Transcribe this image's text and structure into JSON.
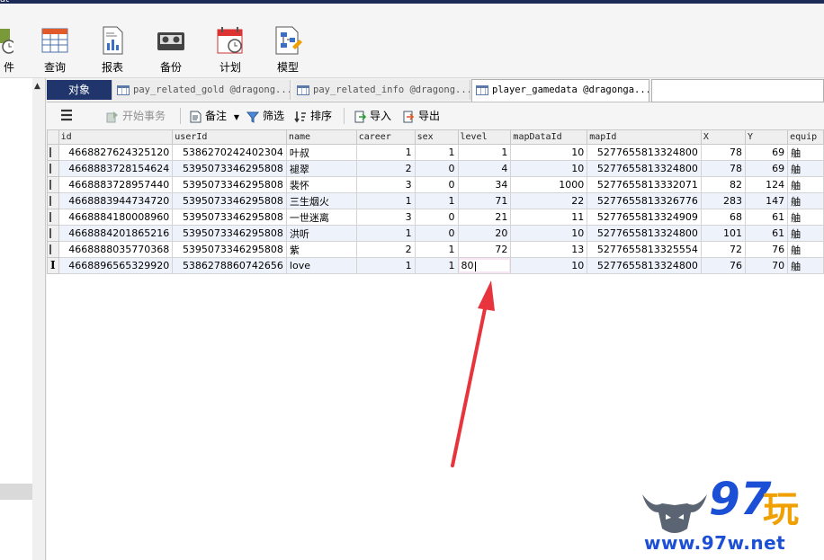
{
  "window": {
    "title_fragment": "at"
  },
  "ribbon": {
    "items": [
      {
        "label": "件",
        "icon": "function-clock-icon"
      },
      {
        "label": "查询",
        "icon": "query-table-icon"
      },
      {
        "label": "报表",
        "icon": "report-icon"
      },
      {
        "label": "备份",
        "icon": "backup-tape-icon"
      },
      {
        "label": "计划",
        "icon": "schedule-calendar-icon"
      },
      {
        "label": "模型",
        "icon": "model-diagram-icon"
      }
    ]
  },
  "tabs": {
    "objects_label": "对象",
    "items": [
      {
        "label": "pay_related_gold @dragong..."
      },
      {
        "label": "pay_related_info @dragong..."
      },
      {
        "label": "player_gamedata @dragonga..."
      }
    ]
  },
  "toolbar": {
    "menu_icon": "hamburger-menu-icon",
    "begin_transaction": "开始事务",
    "note": "备注",
    "filter": "筛选",
    "sort": "排序",
    "import": "导入",
    "export": "导出"
  },
  "grid": {
    "columns": [
      "id",
      "userId",
      "name",
      "career",
      "sex",
      "level",
      "mapDataId",
      "mapId",
      "X",
      "Y",
      "equip"
    ],
    "rows": [
      [
        "4668827624325120",
        "5386270242402304",
        "叶叔",
        "1",
        "1",
        "1",
        "10",
        "5277655813324800",
        "78",
        "69",
        "舳"
      ],
      [
        "4668883728154624",
        "5395073346295808",
        "褪翠",
        "2",
        "0",
        "4",
        "10",
        "5277655813324800",
        "78",
        "69",
        "舳"
      ],
      [
        "4668883728957440",
        "5395073346295808",
        "裴怀",
        "3",
        "0",
        "34",
        "1000",
        "5277655813332071",
        "82",
        "124",
        "舳"
      ],
      [
        "4668883944734720",
        "5395073346295808",
        "三生烟火",
        "1",
        "1",
        "71",
        "22",
        "5277655813326776",
        "283",
        "147",
        "舳"
      ],
      [
        "4668884180008960",
        "5395073346295808",
        "一世迷离",
        "3",
        "0",
        "21",
        "11",
        "5277655813324909",
        "68",
        "61",
        "舳"
      ],
      [
        "4668884201865216",
        "5395073346295808",
        "洪听",
        "1",
        "0",
        "20",
        "10",
        "5277655813324800",
        "101",
        "61",
        "舳"
      ],
      [
        "4668888035770368",
        "5395073346295808",
        "紫",
        "2",
        "1",
        "72",
        "13",
        "5277655813325554",
        "72",
        "76",
        "舳"
      ],
      [
        "4668896565329920",
        "5386278860742656",
        "love",
        "1",
        "1",
        "80",
        "10",
        "5277655813324800",
        "76",
        "70",
        "舳"
      ]
    ],
    "editing_row": 7,
    "editing_value": "80"
  },
  "watermark": {
    "number": "97",
    "char": "玩",
    "url": "www.97w.net"
  },
  "colors": {
    "annotation_arrow": "#e8343c",
    "object_tab": "#20356b",
    "watermark_blue": "#1b4fd6",
    "watermark_orange": "#f0a000"
  }
}
